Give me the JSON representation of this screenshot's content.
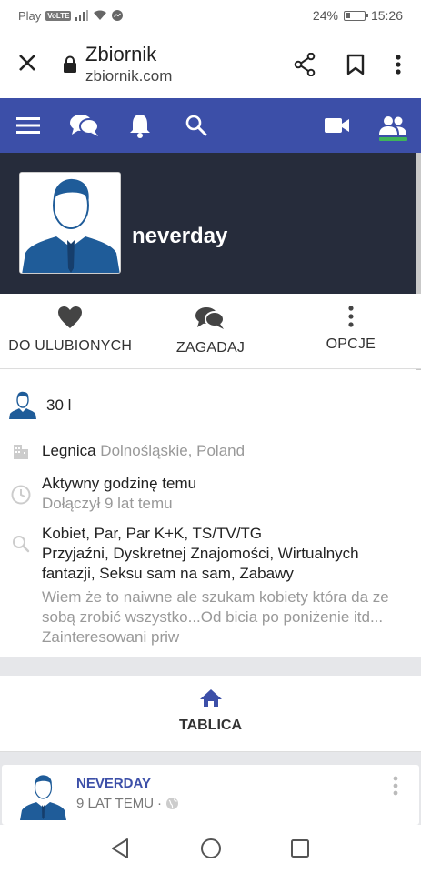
{
  "status_bar": {
    "carrier": "Play",
    "network_badge": "VoLTE",
    "battery_percent": "24%",
    "time": "15:26"
  },
  "browser": {
    "title": "Zbiornik",
    "url": "zbiornik.com",
    "icons": [
      "close-icon",
      "lock-icon",
      "share-icon",
      "bookmark-icon",
      "more-vert-icon"
    ]
  },
  "site_nav": {
    "icons": [
      "menu-icon",
      "chat-icon",
      "bell-icon",
      "search-icon",
      "video-icon",
      "people-icon"
    ],
    "active": "people-icon",
    "accent": "#3c4fa8",
    "active_color": "#40b45a"
  },
  "profile": {
    "username": "neverday",
    "actions": [
      {
        "label": "DO ULUBIONYCH",
        "icon": "heart-icon"
      },
      {
        "label": "ZAGADAJ",
        "icon": "chat-icon"
      },
      {
        "label": "OPCJE",
        "icon": "more-vert-icon"
      }
    ],
    "age": "30 l",
    "city": "Legnica",
    "region": "Dolnośląskie, Poland",
    "active": "Aktywny godzinę temu",
    "joined": "Dołączył 9 lat temu",
    "looking_for": "Kobiet, Par, Par K+K, TS/TV/TG",
    "interests": "Przyjaźni, Dyskretnej Znajomości, Wirtualnych fantazji, Seksu sam na sam, Zabawy",
    "bio": "Wiem że to naiwne ale szukam kobiety która da ze sobą zrobić wszystko...Od bicia po poniżenie itd... Zainteresowani priw"
  },
  "wall": {
    "label": "TABLICA",
    "icon": "home-icon"
  },
  "post": {
    "author": "NEVERDAY",
    "time": "9 LAT TEMU",
    "separator": "·",
    "visibility_icon": "globe-icon"
  },
  "system_nav": [
    "back-icon",
    "home-circle-icon",
    "recents-icon"
  ]
}
